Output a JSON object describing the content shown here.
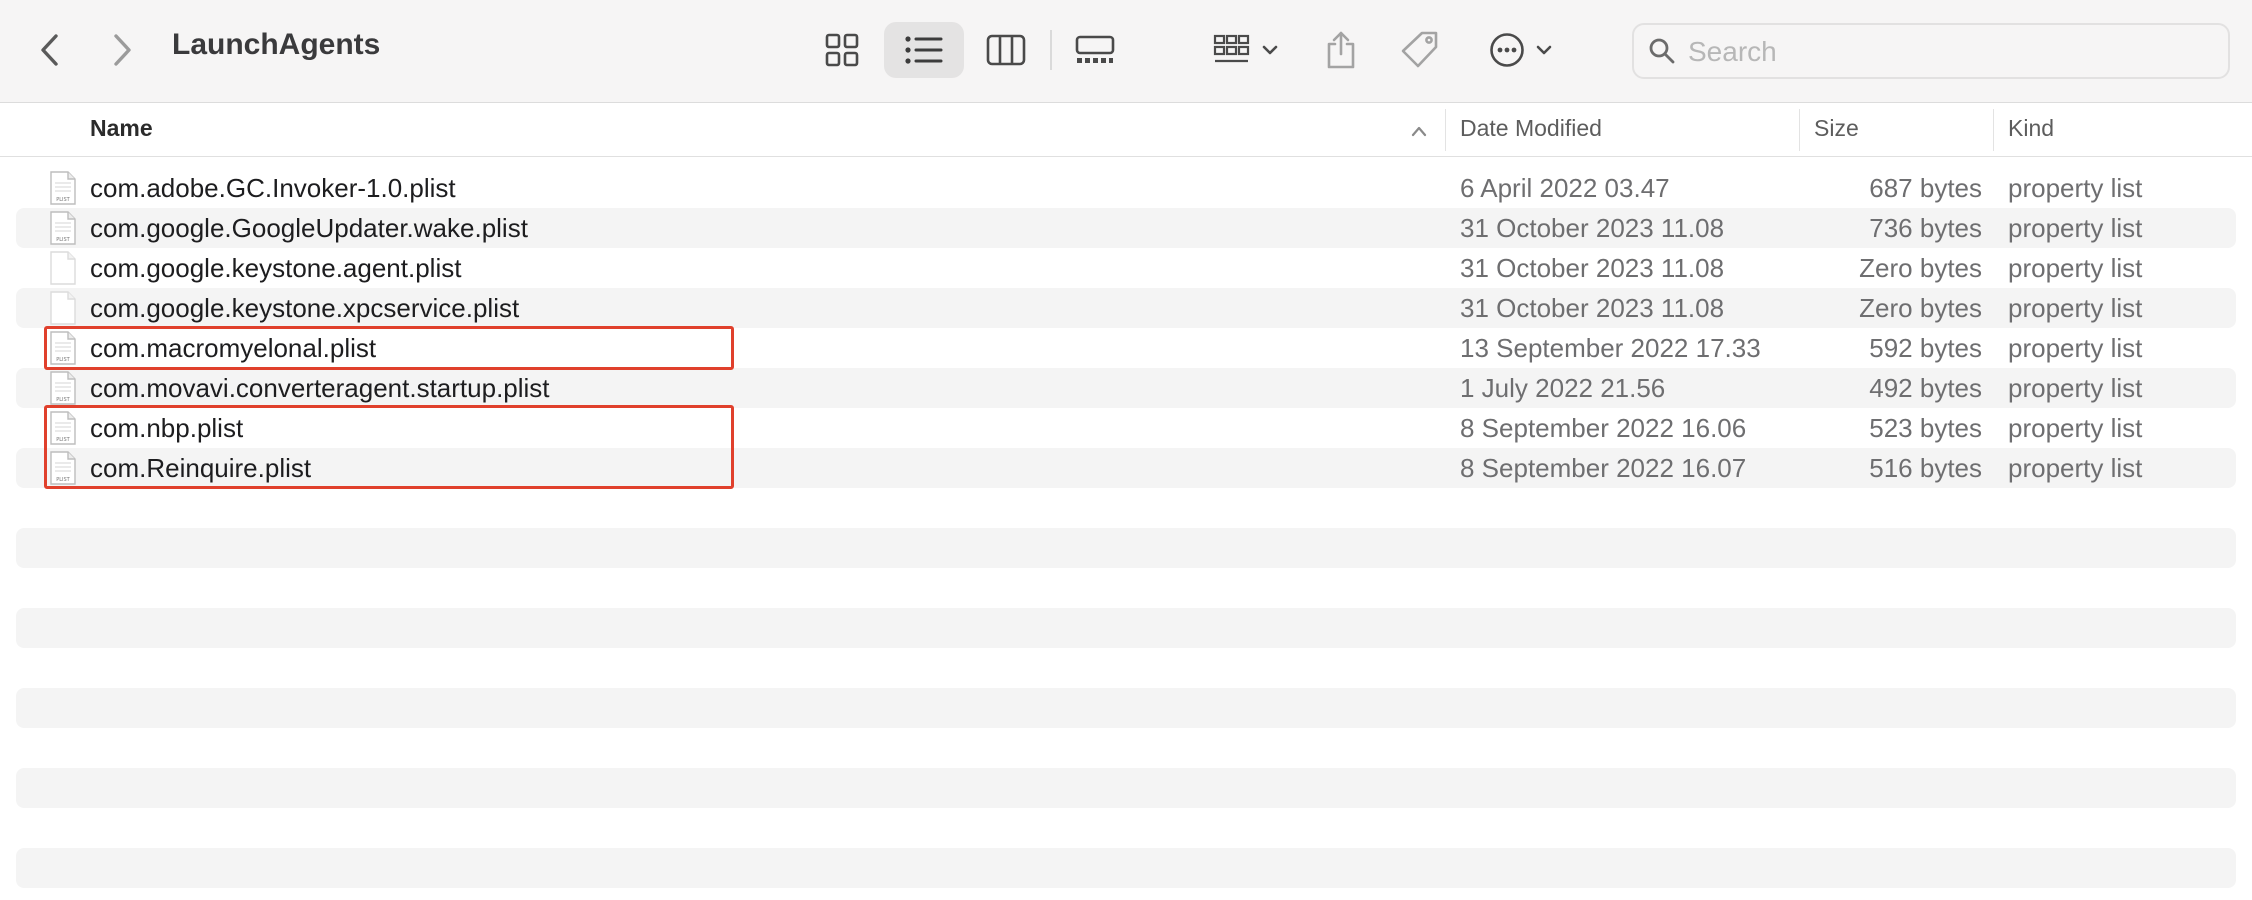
{
  "window": {
    "title": "LaunchAgents"
  },
  "toolbar": {
    "back_icon": "chevron-left-icon",
    "forward_icon": "chevron-right-icon",
    "view_icons": [
      "grid-view-icon",
      "list-view-icon",
      "column-view-icon",
      "gallery-view-icon"
    ],
    "active_view": "list-view-icon",
    "group_icon": "group-by-icon",
    "share_icon": "share-icon",
    "tag_icon": "tag-icon",
    "more_icon": "ellipsis-circle-icon"
  },
  "search": {
    "placeholder": "Search",
    "value": ""
  },
  "columns": {
    "name": "Name",
    "date": "Date Modified",
    "size": "Size",
    "kind": "Kind"
  },
  "files": [
    {
      "name": "com.adobe.GC.Invoker-1.0.plist",
      "date": "6 April 2022 03.47",
      "size": "687 bytes",
      "kind": "property list",
      "icon": "plist-file-icon"
    },
    {
      "name": "com.google.GoogleUpdater.wake.plist",
      "date": "31 October 2023 11.08",
      "size": "736 bytes",
      "kind": "property list",
      "icon": "plist-file-icon"
    },
    {
      "name": "com.google.keystone.agent.plist",
      "date": "31 October 2023 11.08",
      "size": "Zero bytes",
      "kind": "property list",
      "icon": "blank-file-icon"
    },
    {
      "name": "com.google.keystone.xpcservice.plist",
      "date": "31 October 2023 11.08",
      "size": "Zero bytes",
      "kind": "property list",
      "icon": "blank-file-icon"
    },
    {
      "name": "com.macromyelonal.plist",
      "date": "13 September 2022 17.33",
      "size": "592 bytes",
      "kind": "property list",
      "icon": "plist-file-icon"
    },
    {
      "name": "com.movavi.converteragent.startup.plist",
      "date": "1 July 2022 21.56",
      "size": "492 bytes",
      "kind": "property list",
      "icon": "plist-file-icon"
    },
    {
      "name": "com.nbp.plist",
      "date": "8 September 2022 16.06",
      "size": "523 bytes",
      "kind": "property list",
      "icon": "plist-file-icon"
    },
    {
      "name": "com.Reinquire.plist",
      "date": "8 September 2022 16.07",
      "size": "516 bytes",
      "kind": "property list",
      "icon": "plist-file-icon"
    }
  ],
  "colors": {
    "highlight": "#e0402c",
    "stripe": "#f4f4f4"
  }
}
